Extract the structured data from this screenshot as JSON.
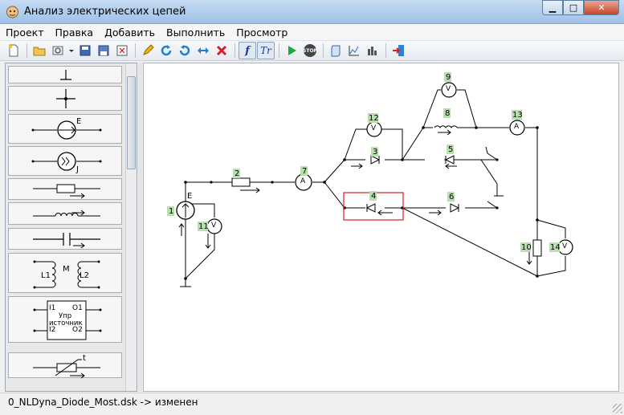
{
  "window": {
    "title": "Анализ электрических цепей"
  },
  "menu": {
    "items": [
      "Проект",
      "Правка",
      "Добавить",
      "Выполнить",
      "Просмотр"
    ]
  },
  "toolbar": {
    "buttons": [
      "new-icon",
      "open-icon",
      "properties-icon",
      "dropdown-icon",
      "save-icon",
      "save-as-icon",
      "export-icon",
      "pencil-icon",
      "rotate-right-icon",
      "rotate-left-icon",
      "flip-icon",
      "delete-icon",
      "f-toggle",
      "tr-toggle",
      "run-icon",
      "stop-icon",
      "script-icon",
      "graph-icon",
      "bars-icon",
      "exit-icon"
    ],
    "f_label": "f",
    "tr_label": "Tr",
    "stop_label": "STOP"
  },
  "palette": {
    "emf_label": "E",
    "current_label": "J",
    "transformer": {
      "m": "M",
      "l1": "L1",
      "l2": "L2"
    },
    "source": {
      "i1": "I1",
      "i2": "I2",
      "o1": "O1",
      "o2": "O2",
      "line1": "Упр",
      "line2": "источник"
    },
    "thermistor_label": "t"
  },
  "circuit": {
    "e_label": "E",
    "voltmeter": "V",
    "ammeter": "A",
    "element_numbers": [
      "1",
      "2",
      "3",
      "4",
      "5",
      "6",
      "7",
      "8",
      "9",
      "10",
      "11",
      "12",
      "13",
      "14"
    ]
  },
  "status": {
    "text": "0_NLDyna_Diode_Most.dsk -> изменен"
  }
}
